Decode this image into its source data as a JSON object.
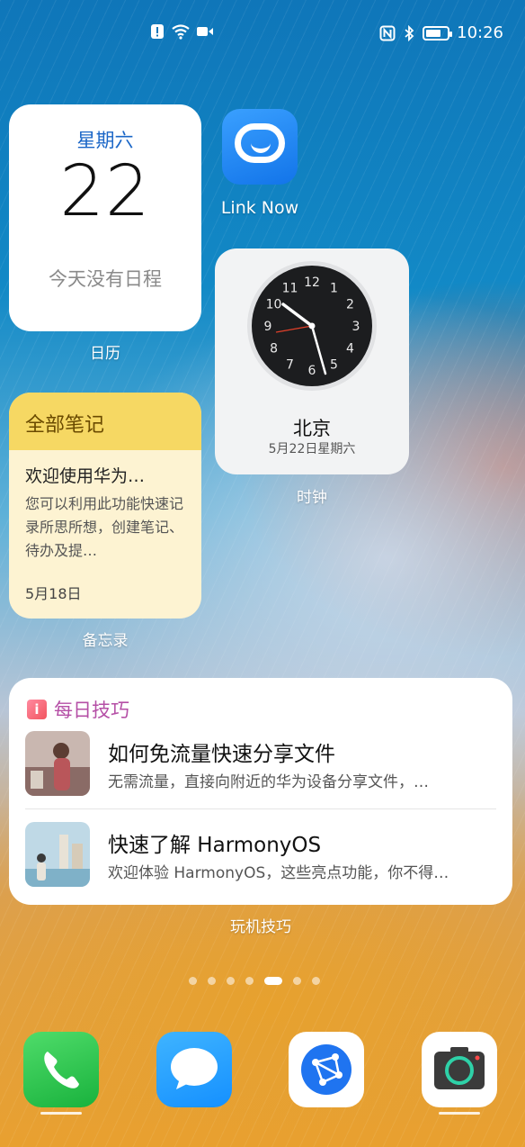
{
  "status_bar": {
    "time": "10:26",
    "battery_percent": 75,
    "wifi_label": "6"
  },
  "home": {
    "calendar": {
      "weekday": "星期六",
      "day": "22",
      "empty_text": "今天没有日程",
      "label": "日历"
    },
    "link_now": {
      "label": "Link Now"
    },
    "clock": {
      "city": "北京",
      "date": "5月22日星期六",
      "label": "时钟",
      "hours": [
        12,
        1,
        2,
        3,
        4,
        5,
        6,
        7,
        8,
        9,
        10,
        11
      ]
    },
    "notes": {
      "header": "全部笔记",
      "item_title": "欢迎使用华为…",
      "item_text": "您可以利用此功能快速记录所思所想，创建笔记、待办及提…",
      "date": "5月18日",
      "label": "备忘录"
    },
    "tips": {
      "header": "每日技巧",
      "items": [
        {
          "title": "如何免流量快速分享文件",
          "desc": "无需流量，直接向附近的华为设备分享文件，…"
        },
        {
          "title": "快速了解 HarmonyOS",
          "desc": "欢迎体验 HarmonyOS，这些亮点功能，你不得…"
        }
      ],
      "label": "玩机技巧"
    },
    "page_indicator": {
      "count": 7,
      "active_index": 4
    }
  },
  "dock": [
    {
      "name": "phone",
      "icon": "phone-icon"
    },
    {
      "name": "messages",
      "icon": "message-icon"
    },
    {
      "name": "browser",
      "icon": "browser-icon"
    },
    {
      "name": "camera",
      "icon": "camera-icon"
    }
  ],
  "colors": {
    "accent_blue": "#1a66c7",
    "notes_yellow": "#f6d863",
    "tips_purple": "#b54fa6"
  }
}
